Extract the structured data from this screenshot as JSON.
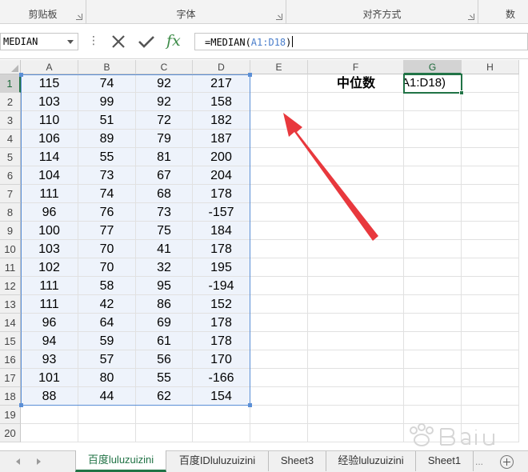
{
  "ribbon": {
    "groups": [
      {
        "label": "剪贴板"
      },
      {
        "label": "字体"
      },
      {
        "label": "对齐方式"
      },
      {
        "label": "数"
      }
    ]
  },
  "formula_bar": {
    "name_box": "MEDIAN",
    "dots": "⋮",
    "fx_label": "fx",
    "formula_prefix": "=MEDIAN(",
    "formula_ref": "A1:D18",
    "formula_suffix": ")"
  },
  "sheet": {
    "columns": [
      "A",
      "B",
      "C",
      "D",
      "E",
      "F",
      "G",
      "H"
    ],
    "rows": [
      "1",
      "2",
      "3",
      "4",
      "5",
      "6",
      "7",
      "8",
      "9",
      "10",
      "11",
      "12",
      "13",
      "14",
      "15",
      "16",
      "17",
      "18",
      "19",
      "20"
    ],
    "data": [
      [
        115,
        74,
        92,
        217
      ],
      [
        103,
        99,
        92,
        158
      ],
      [
        110,
        51,
        72,
        182
      ],
      [
        106,
        89,
        79,
        187
      ],
      [
        114,
        55,
        81,
        200
      ],
      [
        104,
        73,
        67,
        204
      ],
      [
        111,
        74,
        68,
        178
      ],
      [
        96,
        76,
        73,
        -157
      ],
      [
        100,
        77,
        75,
        184
      ],
      [
        103,
        70,
        41,
        178
      ],
      [
        102,
        70,
        32,
        195
      ],
      [
        111,
        58,
        95,
        -194
      ],
      [
        111,
        42,
        86,
        152
      ],
      [
        96,
        64,
        69,
        178
      ],
      [
        94,
        59,
        61,
        178
      ],
      [
        93,
        57,
        56,
        170
      ],
      [
        101,
        80,
        55,
        -166
      ],
      [
        88,
        44,
        62,
        154
      ]
    ],
    "label_cell_text": "中位数",
    "active_cell_text": "A1:D18)",
    "active_column": "G",
    "active_row": "1"
  },
  "tabs": {
    "items": [
      {
        "label": "百度luluzuizini",
        "active": true
      },
      {
        "label": "百度IDluluzuizini",
        "active": false
      },
      {
        "label": "Sheet3",
        "active": false
      },
      {
        "label": "经验luluzuizini",
        "active": false
      },
      {
        "label": "Sheet1",
        "active": false
      }
    ],
    "ellipsis": "..."
  },
  "colors": {
    "accent_green": "#217346",
    "range_blue": "#5b8fd6",
    "range_fill": "#eef3fb",
    "arrow_red": "#e8383d",
    "fx_green": "#3c8b47"
  },
  "icons": [
    "cancel-icon",
    "enter-check-icon",
    "fx-icon",
    "dropdown-arrow-icon",
    "dialog-launcher-icon",
    "add-sheet-icon",
    "scroll-left-icon",
    "scroll-right-icon"
  ]
}
